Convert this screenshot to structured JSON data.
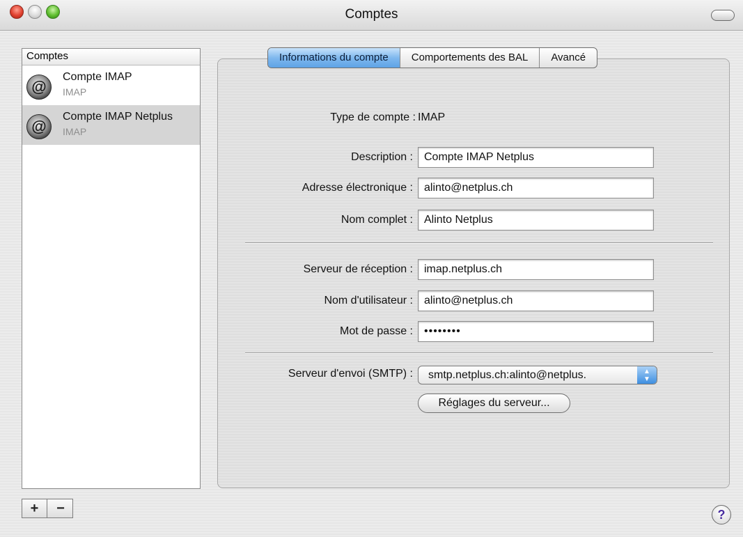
{
  "window": {
    "title": "Comptes"
  },
  "sidebar": {
    "header": "Comptes",
    "accounts": [
      {
        "name": "Compte IMAP",
        "type": "IMAP",
        "icon": "at-sign-icon"
      },
      {
        "name": "Compte IMAP Netplus",
        "type": "IMAP",
        "icon": "at-sign-icon",
        "selected": true
      }
    ],
    "add_label": "+",
    "remove_label": "−"
  },
  "tabs": [
    {
      "label": "Informations du compte",
      "active": true
    },
    {
      "label": "Comportements des BAL"
    },
    {
      "label": "Avancé"
    }
  ],
  "form": {
    "account_type_label": "Type de compte :",
    "account_type_value": "IMAP",
    "description_label": "Description :",
    "description_value": "Compte IMAP Netplus",
    "email_label": "Adresse électronique :",
    "email_value": "alinto@netplus.ch",
    "fullname_label": "Nom complet :",
    "fullname_value": "Alinto Netplus",
    "incoming_label": "Serveur de réception :",
    "incoming_value": "imap.netplus.ch",
    "username_label": "Nom d'utilisateur :",
    "username_value": "alinto@netplus.ch",
    "password_label": "Mot de passe :",
    "password_value": "••••••••",
    "smtp_label": "Serveur d'envoi (SMTP) :",
    "smtp_value": "smtp.netplus.ch:alinto@netplus.",
    "server_settings_button": "Réglages du serveur..."
  },
  "help_label": "?",
  "colors": {
    "selected_tab": "#5ea3e6",
    "selected_row": "#d5d5d5"
  }
}
